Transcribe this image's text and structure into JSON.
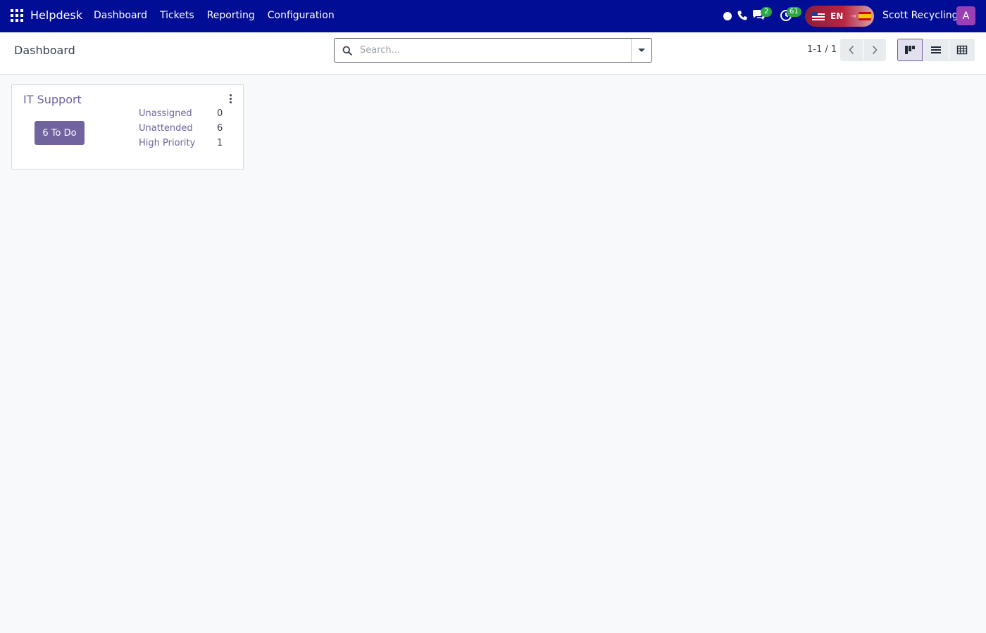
{
  "navbar": {
    "app_name": "Helpdesk",
    "menu": [
      "Dashboard",
      "Tickets",
      "Reporting",
      "Configuration"
    ],
    "chat_count": "2",
    "activity_count": "61",
    "lang_code": "EN",
    "lang_arrow": "→",
    "company": "Scott Recycling",
    "avatar_initial": "A"
  },
  "control_panel": {
    "title": "Dashboard",
    "search_placeholder": "Search...",
    "pager": "1-1 / 1"
  },
  "card": {
    "team": "IT Support",
    "todo_label": "6 To Do",
    "stats": [
      {
        "label": "Unassigned",
        "value": "0"
      },
      {
        "label": "Unattended",
        "value": "6"
      },
      {
        "label": "High Priority",
        "value": "1"
      }
    ]
  },
  "colors": {
    "navbar": "#020d95",
    "accent": "#71639e",
    "badge": "#28a745"
  }
}
